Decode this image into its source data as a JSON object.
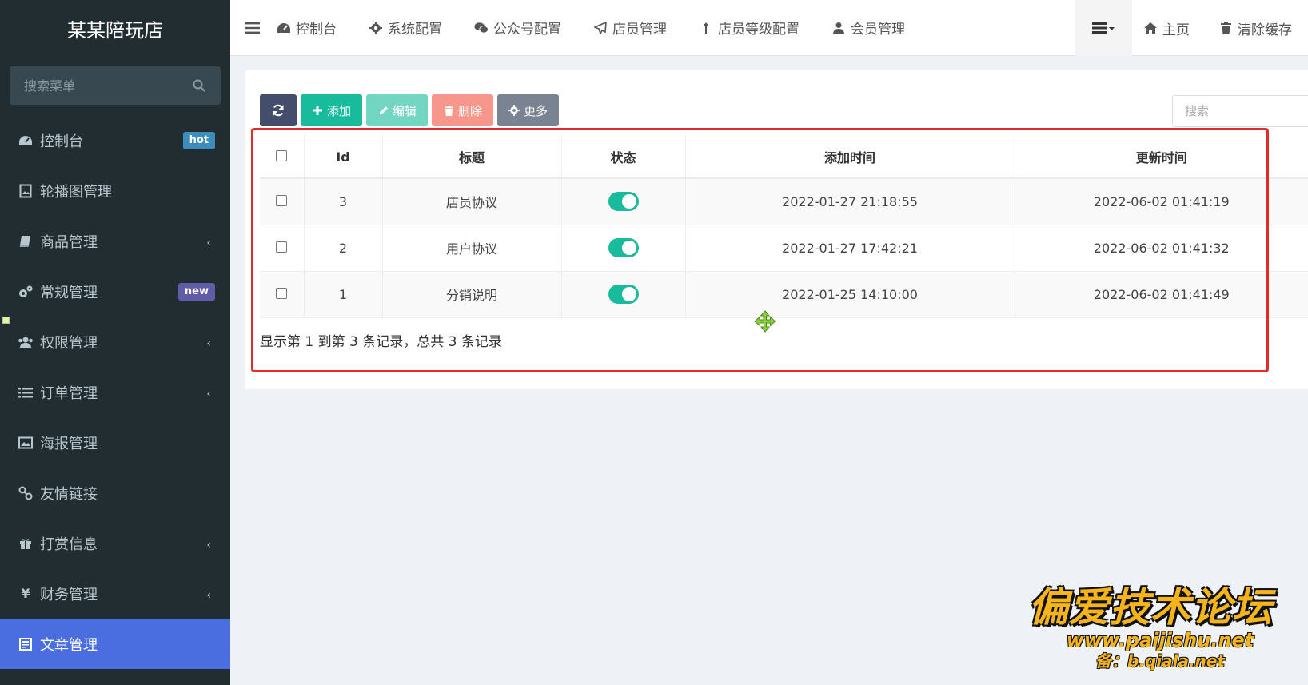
{
  "sidebar": {
    "logo": "某某陪玩店",
    "search_placeholder": "搜索菜单",
    "items": [
      {
        "label": "控制台",
        "icon": "dashboard-icon",
        "badge": "hot",
        "badge_color": "#3c8dbc"
      },
      {
        "label": "轮播图管理",
        "icon": "image-file-icon"
      },
      {
        "label": "商品管理",
        "icon": "book-icon",
        "chevron": "‹"
      },
      {
        "label": "常规管理",
        "icon": "gears-icon",
        "badge": "new",
        "badge_color": "#605ca8"
      },
      {
        "label": "权限管理",
        "icon": "group-icon",
        "chevron": "‹"
      },
      {
        "label": "订单管理",
        "icon": "list-icon",
        "chevron": "‹"
      },
      {
        "label": "海报管理",
        "icon": "picture-icon"
      },
      {
        "label": "友情链接",
        "icon": "link-icon"
      },
      {
        "label": "打赏信息",
        "icon": "gift-icon",
        "chevron": "‹"
      },
      {
        "label": "财务管理",
        "icon": "yen-icon",
        "chevron": "‹"
      },
      {
        "label": "文章管理",
        "icon": "article-icon",
        "active": true
      }
    ]
  },
  "topnav": {
    "items": [
      {
        "label": "控制台",
        "icon": "dashboard-icon"
      },
      {
        "label": "系统配置",
        "icon": "gear-icon"
      },
      {
        "label": "公众号配置",
        "icon": "wechat-icon"
      },
      {
        "label": "店员管理",
        "icon": "paper-plane-icon"
      },
      {
        "label": "店员等级配置",
        "icon": "level-up-icon"
      },
      {
        "label": "会员管理",
        "icon": "user-icon"
      }
    ],
    "home": "主页",
    "clear_cache": "清除缓存"
  },
  "toolbar": {
    "add": "添加",
    "edit": "编辑",
    "delete": "删除",
    "more": "更多",
    "search_placeholder": "搜索",
    "colors": {
      "refresh": "#444d6b",
      "add": "#18bc9c",
      "edit": "#72d6c3",
      "delete": "#f7968a",
      "more": "#7a8391"
    }
  },
  "table": {
    "columns": [
      "Id",
      "标题",
      "状态",
      "添加时间",
      "更新时间"
    ],
    "rows": [
      {
        "id": "3",
        "title": "店员协议",
        "status": true,
        "created": "2022-01-27 21:18:55",
        "updated": "2022-06-02 01:41:19"
      },
      {
        "id": "2",
        "title": "用户协议",
        "status": true,
        "created": "2022-01-27 17:42:21",
        "updated": "2022-06-02 01:41:32"
      },
      {
        "id": "1",
        "title": "分销说明",
        "status": true,
        "created": "2022-01-25 14:10:00",
        "updated": "2022-06-02 01:41:49"
      }
    ],
    "summary": "显示第 1 到第 3 条记录，总共 3 条记录"
  },
  "watermark": {
    "title": "偏爱技术论坛",
    "url": "www.paijishu.net",
    "mirror": "备：b.qiala.net"
  }
}
